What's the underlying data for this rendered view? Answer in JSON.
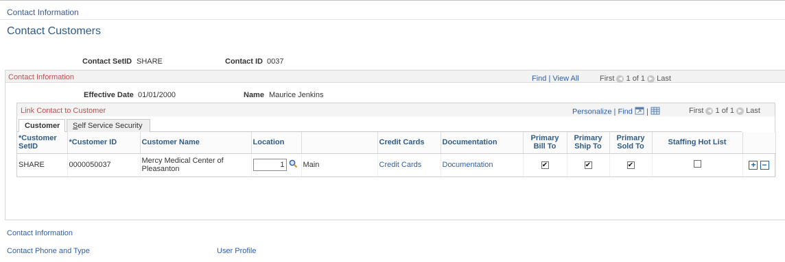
{
  "breadcrumb": "Contact Information",
  "page_title": "Contact Customers",
  "header_fields": {
    "setid_label": "Contact SetID",
    "setid_value": "SHARE",
    "contact_id_label": "Contact ID",
    "contact_id_value": "0037"
  },
  "contact_section": {
    "title": "Contact Information",
    "find": "Find",
    "sep": "|",
    "view_all": "View All",
    "first": "First",
    "paging": "1 of 1",
    "last": "Last",
    "effective_date_label": "Effective Date",
    "effective_date_value": "01/01/2000",
    "name_label": "Name",
    "name_value": "Maurice Jenkins"
  },
  "link_section": {
    "title": "Link Contact to Customer",
    "personalize": "Personalize",
    "sep": "|",
    "find": "Find",
    "first": "First",
    "paging": "1 of 1",
    "last": "Last",
    "tabs": [
      {
        "label": "Customer"
      },
      {
        "label_first": "S",
        "label_rest": "elf Service Security"
      }
    ]
  },
  "grid": {
    "headers": [
      "*Customer SetID",
      "*Customer ID",
      "Customer Name",
      "Location",
      "",
      "Credit Cards",
      "Documentation",
      "Primary Bill To",
      "Primary Ship To",
      "Primary Sold To",
      "Staffing Hot List"
    ],
    "row": {
      "setid": "SHARE",
      "customer_id": "0000050037",
      "customer_name": "Mercy Medical Center of Pleasanton",
      "location": "1",
      "location_desc": "Main",
      "credit_cards": "Credit Cards",
      "documentation": "Documentation",
      "bill_to": "✔",
      "ship_to": "✔",
      "sold_to": "✔",
      "hot_list": ""
    }
  },
  "bottom_links": {
    "contact_information": "Contact Information",
    "contact_phone": "Contact Phone and Type",
    "user_profile": "User Profile"
  },
  "icons": {
    "prev": "◀",
    "next": "▶",
    "search": "magnifier",
    "add": "+",
    "remove": "−"
  }
}
